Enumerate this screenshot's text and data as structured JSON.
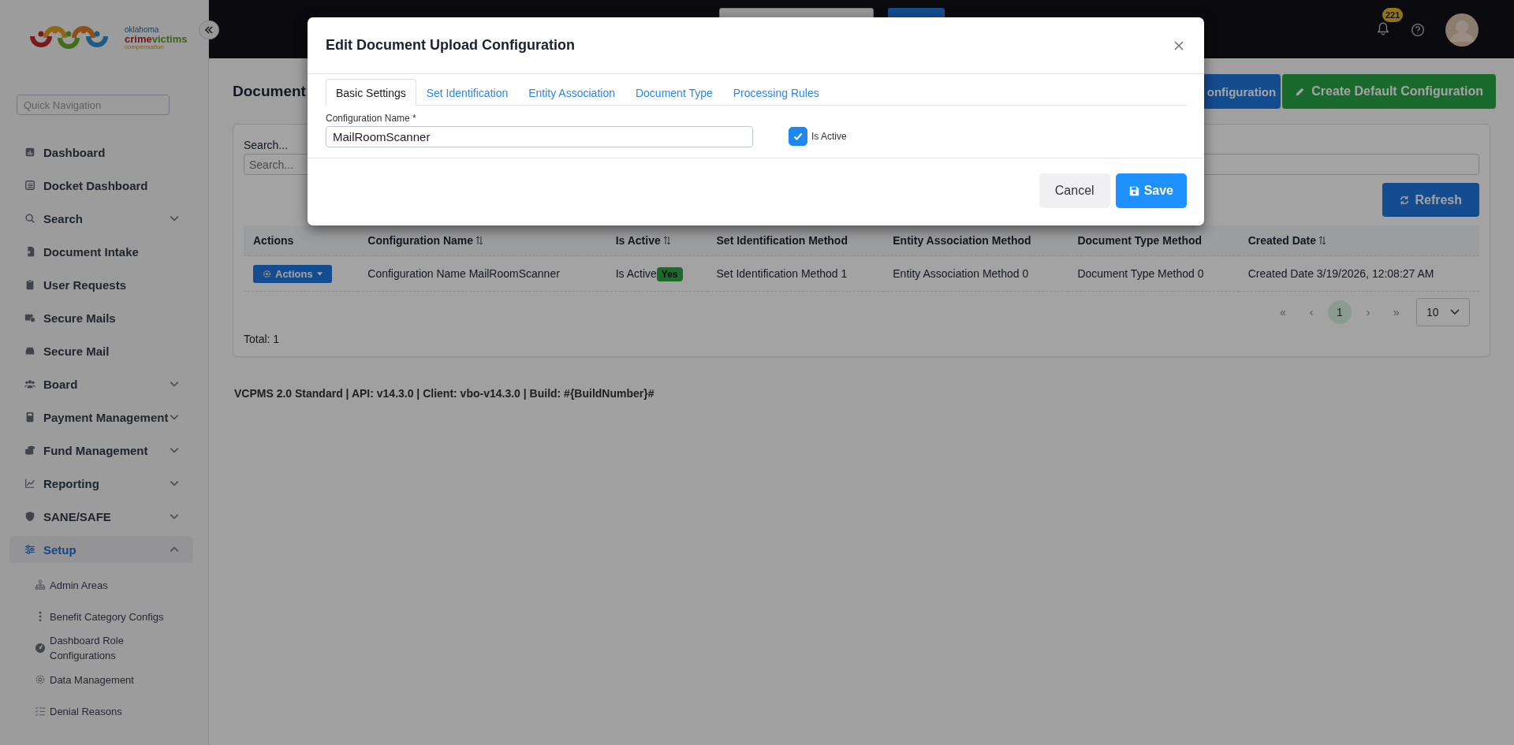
{
  "sidebar": {
    "logo": {
      "state": "oklahoma",
      "crime": "crime",
      "victims": "victims",
      "program": "compensation"
    },
    "quick_navigation": {
      "placeholder": "Quick Navigation"
    },
    "items": [
      {
        "label": "Dashboard",
        "selected": false
      },
      {
        "label": "Docket Dashboard",
        "selected": false
      },
      {
        "label": "Search",
        "expanded": false,
        "selected": false
      },
      {
        "label": "Document Intake",
        "selected": false
      },
      {
        "label": "User Requests",
        "selected": false
      },
      {
        "label": "Secure Mails",
        "selected": false
      },
      {
        "label": "Secure Mail",
        "selected": false
      },
      {
        "label": "Board",
        "expanded": false,
        "selected": false
      },
      {
        "label": "Payment Management",
        "expanded": false,
        "selected": false
      },
      {
        "label": "Fund Management",
        "expanded": false,
        "selected": false
      },
      {
        "label": "Reporting",
        "expanded": false,
        "selected": false
      },
      {
        "label": "SANE/SAFE",
        "expanded": false,
        "selected": false
      },
      {
        "label": "Setup",
        "expanded": true,
        "selected": true,
        "children": [
          {
            "label": "Admin Areas"
          },
          {
            "label": "Benefit Category Configs"
          },
          {
            "label": "Dashboard Role Configurations"
          },
          {
            "label": "Data Management"
          },
          {
            "label": "Denial Reasons"
          }
        ]
      }
    ]
  },
  "header": {
    "notification_count": "221"
  },
  "page": {
    "title": "Document",
    "buttons": [
      {
        "label": "onfiguration",
        "kind": "primary"
      },
      {
        "label": "Create Default Configuration",
        "kind": "success"
      }
    ],
    "search": {
      "label": "Search...",
      "placeholder": "Search..."
    },
    "refresh_button": "Refresh",
    "table": {
      "columns": [
        {
          "label": "Actions",
          "sortable": false
        },
        {
          "label": "Configuration Name",
          "sortable": true
        },
        {
          "label": "Is Active",
          "sortable": true
        },
        {
          "label": "Set Identification Method",
          "sortable": false
        },
        {
          "label": "Entity Association Method",
          "sortable": false
        },
        {
          "label": "Document Type Method",
          "sortable": false
        },
        {
          "label": "Created Date",
          "sortable": true
        }
      ],
      "rows": [
        {
          "cells": [
            {
              "kind": "actions",
              "text": "Actions"
            },
            {
              "kind": "text",
              "text": "Configuration Name MailRoomScanner"
            },
            {
              "kind": "badge",
              "text": "Is Active",
              "badge": "Yes"
            },
            {
              "kind": "text",
              "text": "Set Identification Method 1"
            },
            {
              "kind": "text",
              "text": "Entity Association Method 0"
            },
            {
              "kind": "text",
              "text": "Document Type Method 0"
            },
            {
              "kind": "text",
              "text": "Created Date 3/19/2026, 12:08:27 AM"
            }
          ]
        }
      ]
    },
    "pagination": {
      "first": "«",
      "prev": "‹",
      "pages": [
        {
          "label": "1",
          "selected": true
        }
      ],
      "next": "›",
      "last": "»",
      "page_size": "10"
    },
    "total": "Total: 1",
    "footer": "VCPMS 2.0 Standard | API: v14.3.0 | Client: vbo-v14.3.0 | Build: #{BuildNumber}#"
  },
  "modal": {
    "title": "Edit Document Upload Configuration",
    "tabs": [
      {
        "label": "Basic Settings",
        "selected": true
      },
      {
        "label": "Set Identification",
        "selected": false
      },
      {
        "label": "Entity Association",
        "selected": false
      },
      {
        "label": "Document Type",
        "selected": false
      },
      {
        "label": "Processing Rules",
        "selected": false
      }
    ],
    "name_label": "Configuration Name *",
    "name_value": "MailRoomScanner",
    "active_label": "Is Active",
    "active_checked": true,
    "buttons": [
      {
        "label": "Cancel",
        "kind": "secondary"
      },
      {
        "label": "Save",
        "kind": "primary"
      }
    ]
  }
}
